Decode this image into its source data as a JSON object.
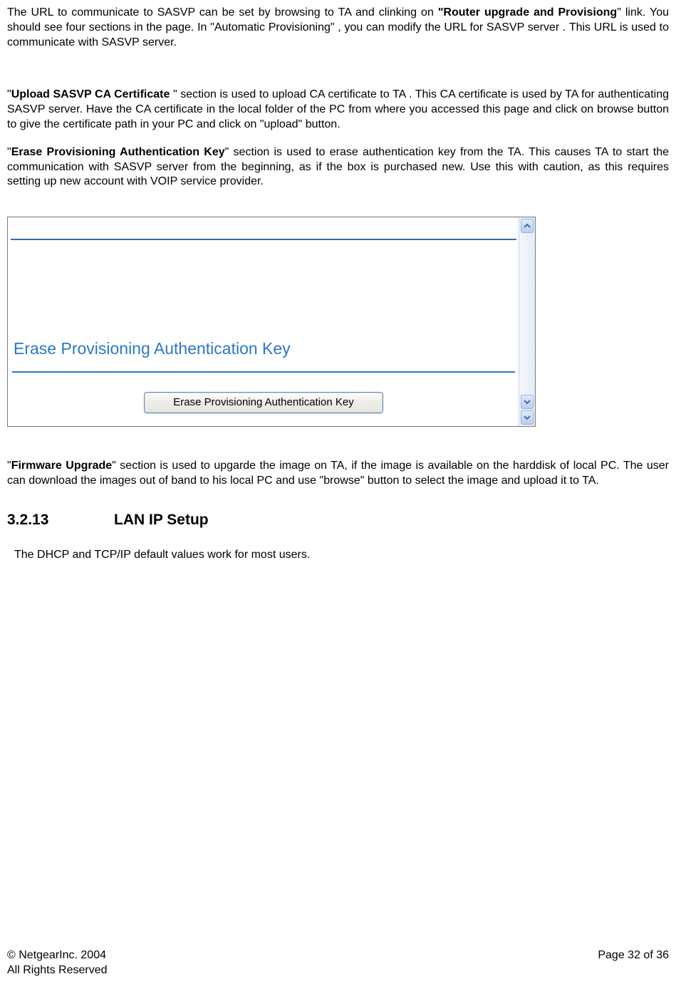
{
  "p1": {
    "a": "The URL to communicate to SASVP can be set by browsing to TA and clinking on ",
    "bold": "\"Router upgrade and Provisiong",
    "b": "\" link. You should see four sections in the page. In \"Automatic Provisioning\" , you can modify the URL for SASVP server . This URL is used to communicate with SASVP server."
  },
  "p2": {
    "a": "\"",
    "bold": "Upload SASVP CA Certificate ",
    "b": "\" section is used to upload CA certificate to TA . This CA certificate is used by TA for authenticating SASVP server. Have the CA certificate in the local folder of the PC from where you accessed this page and click on browse button to give the certificate path in your PC and  click on \"upload\" button."
  },
  "p3": {
    "a": "\"",
    "bold": "Erase Provisioning Authentication Key",
    "b": "\" section is used to erase authentication key from the TA. This causes TA to start the communication with SASVP server  from the beginning, as if the box is purchased new. Use this with caution, as this requires setting up new account with VOIP service provider."
  },
  "screenshot": {
    "section_title": "Erase Provisioning Authentication Key",
    "button_label": "Erase Provisioning Authentication Key"
  },
  "p4": {
    "a": "\"",
    "bold": "Firmware Upgrade",
    "b": "\" section is used to upgarde the image on TA, if the image is available on the harddisk of local PC. The user can download the images out of band to his local PC and use \"browse\" button to select the image and upload it to TA."
  },
  "heading": {
    "number": "3.2.13",
    "title": "LAN IP Setup"
  },
  "p5": " The DHCP and TCP/IP default values work for most users.",
  "footer": {
    "copyright": "© NetgearInc. 2004",
    "rights": "All Rights Reserved",
    "page": "Page 32 of 36"
  }
}
